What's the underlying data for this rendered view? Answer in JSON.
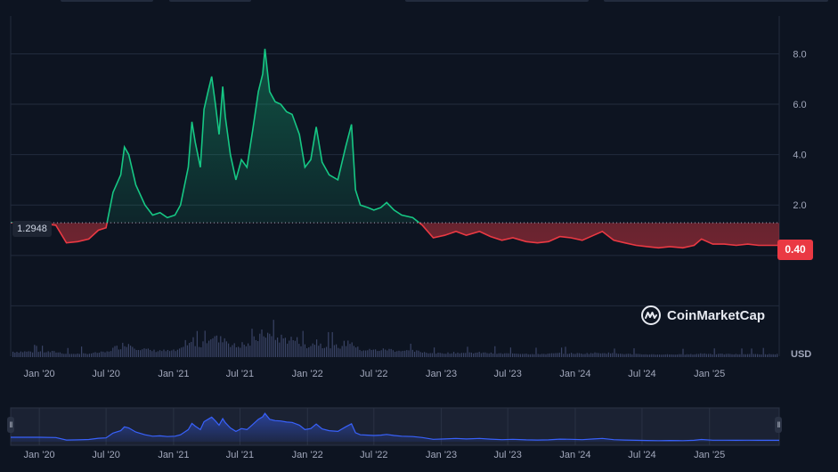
{
  "chart_data": {
    "type": "area",
    "x_ticks": [
      "Jan '20",
      "Jul '20",
      "Jan '21",
      "Jul '21",
      "Jan '22",
      "Jul '22",
      "Jan '23",
      "Jul '23",
      "Jan '24",
      "Jul '24",
      "Jan '25"
    ],
    "y_ticks": [
      "2.0",
      "4.0",
      "6.0",
      "8.0"
    ],
    "ylim": [
      -4,
      9.5
    ],
    "xlim": [
      "2019-10-15",
      "2025-07-10"
    ],
    "baseline": 1.2948,
    "baseline_label": "1.2948",
    "current_price": 0.4,
    "current_price_label": "0.40",
    "currency": "USD",
    "up_color": "#16c784",
    "down_color": "#ea3943",
    "volume_color": "#3a4466",
    "navigator_color": "#3861fb",
    "series": [
      {
        "values": [
          [
            "2019-10-15",
            1.3
          ],
          [
            "2019-11-01",
            1.28
          ],
          [
            "2019-12-01",
            1.3
          ],
          [
            "2020-01-01",
            1.28
          ],
          [
            "2020-02-15",
            1.2
          ],
          [
            "2020-03-15",
            0.5
          ],
          [
            "2020-04-15",
            0.55
          ],
          [
            "2020-05-15",
            0.65
          ],
          [
            "2020-06-10",
            1.0
          ],
          [
            "2020-07-01",
            1.1
          ],
          [
            "2020-07-20",
            2.5
          ],
          [
            "2020-08-10",
            3.2
          ],
          [
            "2020-08-20",
            4.3
          ],
          [
            "2020-09-01",
            4.0
          ],
          [
            "2020-09-20",
            2.8
          ],
          [
            "2020-10-15",
            2.0
          ],
          [
            "2020-11-05",
            1.6
          ],
          [
            "2020-11-25",
            1.7
          ],
          [
            "2020-12-15",
            1.5
          ],
          [
            "2021-01-05",
            1.6
          ],
          [
            "2021-01-20",
            2.0
          ],
          [
            "2021-02-10",
            3.5
          ],
          [
            "2021-02-20",
            5.3
          ],
          [
            "2021-03-01",
            4.5
          ],
          [
            "2021-03-15",
            3.5
          ],
          [
            "2021-03-25",
            5.8
          ],
          [
            "2021-04-05",
            6.5
          ],
          [
            "2021-04-15",
            7.1
          ],
          [
            "2021-04-25",
            6.0
          ],
          [
            "2021-05-05",
            4.8
          ],
          [
            "2021-05-15",
            6.7
          ],
          [
            "2021-05-22",
            5.5
          ],
          [
            "2021-06-05",
            4.0
          ],
          [
            "2021-06-20",
            3.0
          ],
          [
            "2021-07-05",
            3.8
          ],
          [
            "2021-07-20",
            3.5
          ],
          [
            "2021-08-05",
            5.0
          ],
          [
            "2021-08-20",
            6.5
          ],
          [
            "2021-09-01",
            7.2
          ],
          [
            "2021-09-07",
            8.2
          ],
          [
            "2021-09-20",
            6.5
          ],
          [
            "2021-10-05",
            6.1
          ],
          [
            "2021-10-20",
            6.0
          ],
          [
            "2021-11-05",
            5.7
          ],
          [
            "2021-11-20",
            5.6
          ],
          [
            "2021-12-10",
            4.8
          ],
          [
            "2021-12-25",
            3.5
          ],
          [
            "2022-01-10",
            3.8
          ],
          [
            "2022-01-25",
            5.1
          ],
          [
            "2022-02-10",
            3.7
          ],
          [
            "2022-03-01",
            3.2
          ],
          [
            "2022-03-25",
            3.0
          ],
          [
            "2022-04-15",
            4.3
          ],
          [
            "2022-05-01",
            5.2
          ],
          [
            "2022-05-12",
            2.6
          ],
          [
            "2022-05-25",
            2.0
          ],
          [
            "2022-06-15",
            1.9
          ],
          [
            "2022-07-01",
            1.8
          ],
          [
            "2022-07-20",
            1.9
          ],
          [
            "2022-08-05",
            2.1
          ],
          [
            "2022-08-25",
            1.8
          ],
          [
            "2022-09-15",
            1.6
          ],
          [
            "2022-10-15",
            1.5
          ],
          [
            "2022-11-10",
            1.2
          ],
          [
            "2022-12-10",
            0.7
          ],
          [
            "2023-01-10",
            0.8
          ],
          [
            "2023-02-10",
            0.95
          ],
          [
            "2023-03-10",
            0.8
          ],
          [
            "2023-04-15",
            0.95
          ],
          [
            "2023-05-15",
            0.75
          ],
          [
            "2023-06-15",
            0.6
          ],
          [
            "2023-07-15",
            0.7
          ],
          [
            "2023-08-20",
            0.55
          ],
          [
            "2023-09-20",
            0.5
          ],
          [
            "2023-10-20",
            0.55
          ],
          [
            "2023-11-20",
            0.75
          ],
          [
            "2023-12-20",
            0.7
          ],
          [
            "2024-01-20",
            0.6
          ],
          [
            "2024-02-20",
            0.8
          ],
          [
            "2024-03-15",
            0.95
          ],
          [
            "2024-04-15",
            0.6
          ],
          [
            "2024-05-15",
            0.5
          ],
          [
            "2024-06-15",
            0.4
          ],
          [
            "2024-07-15",
            0.35
          ],
          [
            "2024-08-15",
            0.3
          ],
          [
            "2024-09-15",
            0.35
          ],
          [
            "2024-10-20",
            0.3
          ],
          [
            "2024-11-20",
            0.4
          ],
          [
            "2024-12-10",
            0.65
          ],
          [
            "2025-01-10",
            0.45
          ],
          [
            "2025-02-10",
            0.45
          ],
          [
            "2025-03-15",
            0.4
          ],
          [
            "2025-04-15",
            0.45
          ],
          [
            "2025-05-15",
            0.4
          ],
          [
            "2025-06-15",
            0.4
          ],
          [
            "2025-07-10",
            0.4
          ]
        ]
      }
    ]
  },
  "watermark": {
    "brand": "CoinMarketCap",
    "icon": "coinmarketcap-logo-icon"
  }
}
